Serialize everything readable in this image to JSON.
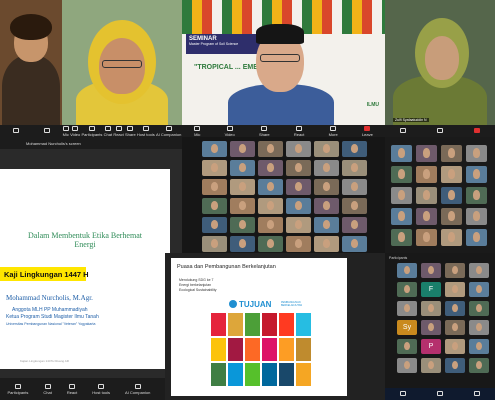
{
  "panels": {
    "p1": {
      "name": "Mohammad Nurcholis's screen",
      "toolbar": [
        "Participants",
        "Chat",
        "React",
        "Host tools",
        "AI Companion",
        "Apps"
      ]
    },
    "p2": {
      "toolbar": [
        "Mic",
        "Video",
        "Participants",
        "Chat",
        "React",
        "Share",
        "Host tools",
        "AI Companion"
      ]
    },
    "p3": {
      "banner": "SEMINAR",
      "banner_sub": "Master Program of Soil Science",
      "headline": "\"TROPICAL ... EMENT\"",
      "logo": "ILMU",
      "toolbar": [
        "Mic",
        "Video",
        "Share",
        "React",
        "More",
        "Leave"
      ]
    },
    "p4": {
      "name": "Zulfi Syafaatuddin N"
    },
    "slide": {
      "title_line1": "Dalam Membentuk Etika Berhemat",
      "title_line2": "Energi",
      "highlight": "Kaji Lingkungan 1447 H",
      "speaker": "Mohammad Nurcholis, M.Agr.",
      "role1": "Anggota MLH PP Muhammadiyah",
      "role2": "Ketua Program Studi Magister Ilmu Tanah",
      "uni": "Universitas Pembangunan Nasional \"Veteran\" Yogyakarta",
      "footer": "Kajian Lingkungan 1447H Ruang AR"
    },
    "sdg": {
      "title": "Puasa dan Pembangunan Berkelanjutan",
      "bullets": [
        "Mendukung SDG ke 7",
        "Energi berkelanjutan",
        "Ecological Sustainability"
      ],
      "tujuan": "TUJUAN",
      "tujuan_sub": "PEMBANGUNAN BERKELANJUTAN"
    },
    "right_list": {
      "header": "Participants",
      "tiles": [
        {
          "initial": "F",
          "color": "#1a7f6b"
        },
        {
          "initial": "Sy",
          "color": "#c98a1e"
        },
        {
          "initial": "P",
          "color": "#b5306d"
        }
      ]
    }
  },
  "colors": {
    "accent_green": "#2e8b57",
    "highlight_yellow": "#ffe600",
    "zoom_dark": "#1c1c1c"
  }
}
